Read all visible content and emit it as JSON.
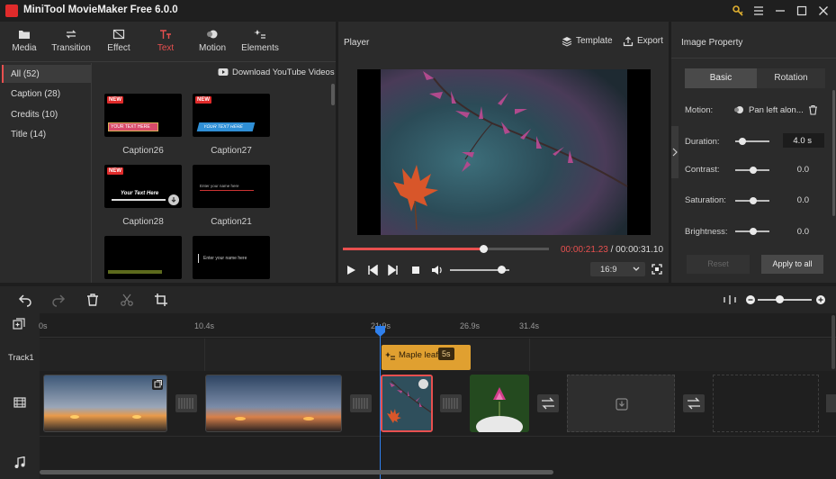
{
  "app": {
    "title": "MiniTool MovieMaker Free 6.0.0"
  },
  "toolbar": {
    "tabs": [
      {
        "label": "Media",
        "icon": "folder-icon"
      },
      {
        "label": "Transition",
        "icon": "transition-arrows-icon"
      },
      {
        "label": "Effect",
        "icon": "effect-icon"
      },
      {
        "label": "Text",
        "icon": "text-icon",
        "active": true
      },
      {
        "label": "Motion",
        "icon": "motion-icon"
      },
      {
        "label": "Elements",
        "icon": "elements-icon"
      }
    ]
  },
  "library": {
    "categories": [
      "All (52)",
      "Caption (28)",
      "Credits (10)",
      "Title (14)"
    ],
    "download_link": "Download YouTube Videos",
    "items": [
      {
        "name": "Caption26",
        "badge": "NEW",
        "sample": "YOUR TEXT HERE"
      },
      {
        "name": "Caption27",
        "badge": "NEW",
        "sample": "YOUR TEXT HERE"
      },
      {
        "name": "Caption28",
        "badge": "NEW",
        "sample": "Your Text Here"
      },
      {
        "name": "Caption21",
        "badge": "",
        "sample": "Enter your name here"
      },
      {
        "name": "",
        "badge": "",
        "sample": ""
      },
      {
        "name": "",
        "badge": "",
        "sample": "Enter your name here"
      }
    ]
  },
  "player": {
    "label": "Player",
    "template_label": "Template",
    "export_label": "Export",
    "current_time": "00:00:21.23",
    "total_time": "00:00:31.10",
    "time_separator": " / ",
    "progress": 0.68,
    "volume": 0.8,
    "aspect": "16:9"
  },
  "property": {
    "title": "Image Property",
    "tabs": [
      "Basic",
      "Rotation"
    ],
    "motion_label": "Motion:",
    "motion_value": "Pan left alon...",
    "duration_label": "Duration:",
    "duration_value": "4.0 s",
    "contrast_label": "Contrast:",
    "contrast_value": "0.0",
    "saturation_label": "Saturation:",
    "saturation_value": "0.0",
    "brightness_label": "Brightness:",
    "brightness_value": "0.0",
    "reset_label": "Reset",
    "apply_label": "Apply to all"
  },
  "timeline": {
    "ruler": [
      "0s",
      "10.4s",
      "21.9s",
      "26.9s",
      "31.4s"
    ],
    "track_label": "Track1",
    "text_clip": {
      "name": "Maple leaf",
      "duration": "5s"
    }
  },
  "colors": {
    "accent": "#e8504f",
    "playhead": "#2f80ed",
    "text_clip": "#e0a030"
  }
}
